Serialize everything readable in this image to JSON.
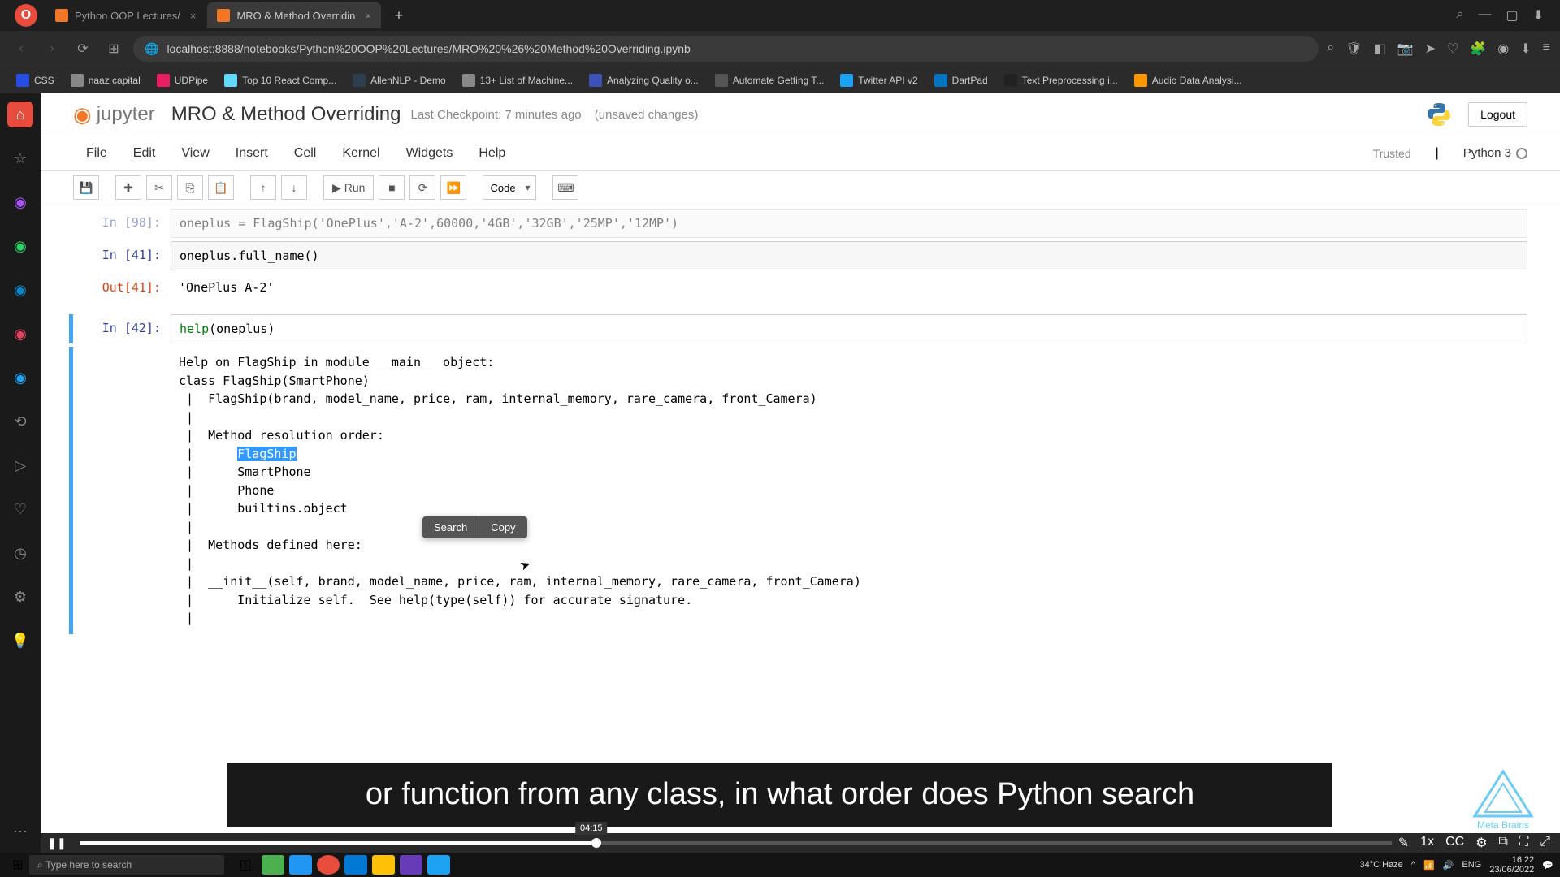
{
  "browser": {
    "tabs": [
      {
        "title": "Python OOP Lectures/",
        "active": false
      },
      {
        "title": "MRO & Method Overridin",
        "active": true
      }
    ],
    "url": "localhost:8888/notebooks/Python%20OOP%20Lectures/MRO%20%26%20Method%20Overriding.ipynb"
  },
  "bookmarks": [
    {
      "label": "CSS"
    },
    {
      "label": "naaz capital"
    },
    {
      "label": "UDPipe"
    },
    {
      "label": "Top 10 React Comp..."
    },
    {
      "label": "AllenNLP - Demo"
    },
    {
      "label": "13+ List of Machine..."
    },
    {
      "label": "Analyzing Quality o..."
    },
    {
      "label": "Automate Getting T..."
    },
    {
      "label": "Twitter API v2"
    },
    {
      "label": "DartPad"
    },
    {
      "label": "Text Preprocessing i..."
    },
    {
      "label": "Audio Data Analysi..."
    }
  ],
  "jupyter": {
    "logo": "jupyter",
    "title": "MRO & Method Overriding",
    "checkpoint": "Last Checkpoint: 7 minutes ago",
    "unsaved": "(unsaved changes)",
    "logout": "Logout",
    "trusted": "Trusted",
    "kernel": "Python 3",
    "menu": [
      "File",
      "Edit",
      "View",
      "Insert",
      "Cell",
      "Kernel",
      "Widgets",
      "Help"
    ],
    "toolbar": {
      "run": "Run",
      "celltype": "Code"
    }
  },
  "cells": {
    "cell0_prompt": "In [98]:",
    "cell0_code": "oneplus = FlagShip('OnePlus','A-2',60000,'4GB','32GB','25MP','12MP')",
    "cell1_prompt": "In [41]:",
    "cell1_code": "oneplus.full_name()",
    "cell1_out_prompt": "Out[41]:",
    "cell1_out": "'OnePlus A-2'",
    "cell2_prompt": "In [42]:",
    "cell2_code_help": "help",
    "cell2_code_arg": "oneplus",
    "help_output": {
      "l1": "Help on FlagShip in module __main__ object:",
      "l2": "",
      "l3": "class FlagShip(SmartPhone)",
      "l4": " |  FlagShip(brand, model_name, price, ram, internal_memory, rare_camera, front_Camera)",
      "l5": " |  ",
      "l6": " |  Method resolution order:",
      "l7a": " |      ",
      "l7b": "FlagShip",
      "l8": " |      SmartPhone",
      "l9": " |      Phone",
      "l10": " |      builtins.object",
      "l11": " |  ",
      "l12": " |  Methods defined here:",
      "l13": " |  ",
      "l14": " |  __init__(self, brand, model_name, price, ram, internal_memory, rare_camera, front_Camera)",
      "l15": " |      Initialize self.  See help(type(self)) for accurate signature.",
      "l16": " |  "
    }
  },
  "tooltip": {
    "search": "Search",
    "copy": "Copy"
  },
  "caption": "or function from any class, in what order does Python search",
  "watermark": "Meta Brains",
  "video": {
    "time_tip": "04:15"
  },
  "taskbar": {
    "search_placeholder": "Type here to search",
    "weather": "34°C  Haze",
    "time": "16:22",
    "date": "23/06/2022"
  }
}
